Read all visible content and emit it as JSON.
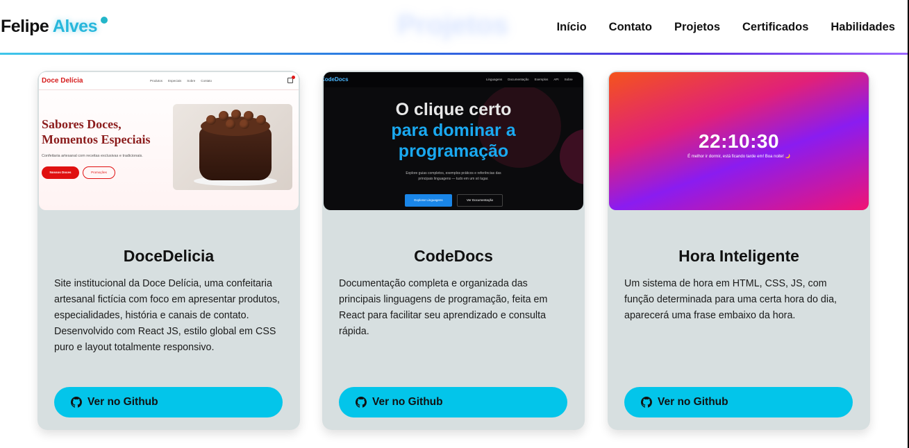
{
  "header": {
    "logo_first": "Felipe",
    "logo_last": "Alves",
    "ghost_title": "Projetos",
    "nav": [
      "Início",
      "Contato",
      "Projetos",
      "Certificados",
      "Habilidades"
    ]
  },
  "projects": [
    {
      "title": "DoceDelicia",
      "description": "Site institucional da Doce Delícia, uma confeitaria artesanal fictícia com foco em apresentar produtos, especialidades, história e canais de contato. Desenvolvido com React JS, estilo global em CSS puro e layout totalmente responsivo.",
      "button": "Ver no Github",
      "preview": {
        "brand": "Doce Delícia",
        "links": [
          "Produtos",
          "Especiais",
          "Sobre",
          "Contato"
        ],
        "headline_1": "Sabores Doces,",
        "headline_2": "Momentos Especiais",
        "subtitle": "Confeitaria artesanal com receitas exclusivas e tradicionais.",
        "btn_primary": "Nossos Doces",
        "btn_secondary": "Promoções"
      }
    },
    {
      "title": "CodeDocs",
      "description": "Documentação completa e organizada das principais linguagens de programação, feita em React para facilitar seu aprendizado e consulta rápida.",
      "button": "Ver no Github",
      "preview": {
        "brand": "CodeDocs",
        "links": [
          "Linguagens",
          "Documentação",
          "Exemplos",
          "API",
          "Sobre"
        ],
        "line_1": "O clique certo",
        "line_2": "para dominar a",
        "line_3": "programação",
        "subtitle_1": "Explore guias completos, exemplos práticos e referências das",
        "subtitle_2": "principais linguagens — tudo em um só lugar.",
        "btn_primary": "Explorar Linguagens",
        "btn_secondary": "Ver Documentação"
      }
    },
    {
      "title": "Hora Inteligente",
      "description": "Um sistema de hora em HTML, CSS, JS, com função determinada para uma certa hora do dia, aparecerá uma frase embaixo da hora.",
      "button": "Ver no Github",
      "preview": {
        "time": "22:10:30",
        "message": "É melhor ir dormir, está ficando tarde em! Boa noite! 🌙"
      }
    }
  ],
  "colors": {
    "accent": "#03c5ea",
    "card_bg": "#d7dfe0",
    "logo_accent": "#27b7dc"
  }
}
